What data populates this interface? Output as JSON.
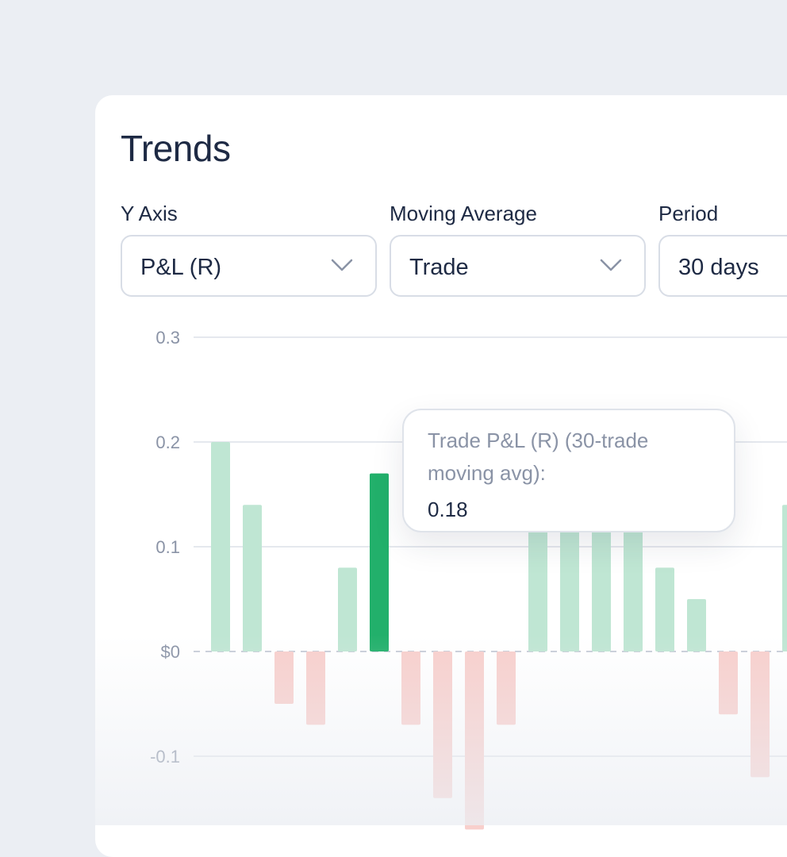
{
  "header": {
    "title": "Trends"
  },
  "controls": [
    {
      "label": "Y Axis",
      "value": "P&L (R)"
    },
    {
      "label": "Moving Average",
      "value": "Trade"
    },
    {
      "label": "Period",
      "value": "30 days"
    }
  ],
  "tooltip": {
    "label": "Trade P&L (R) (30-trade moving avg):",
    "value": "0.18"
  },
  "colors": {
    "positive": "#bfe6d3",
    "positive_highlight": "#22b06b",
    "negative": "#f8cfcc",
    "grid": "#e5e8ee",
    "zero_line": "#c9ced8",
    "tick_text": "#8a93a6"
  },
  "chart_data": {
    "type": "bar",
    "y_ticks": [
      "0.3",
      "0.2",
      "0.1",
      "$0",
      "-0.1"
    ],
    "ylim": [
      -0.16,
      0.3
    ],
    "highlight_index": 5,
    "grid": true,
    "values": [
      0.2,
      0.14,
      -0.05,
      -0.07,
      0.08,
      0.17,
      -0.07,
      -0.14,
      -0.17,
      -0.07,
      0.13,
      0.13,
      0.13,
      0.13,
      0.08,
      0.05,
      -0.06,
      -0.12,
      0.14
    ]
  }
}
